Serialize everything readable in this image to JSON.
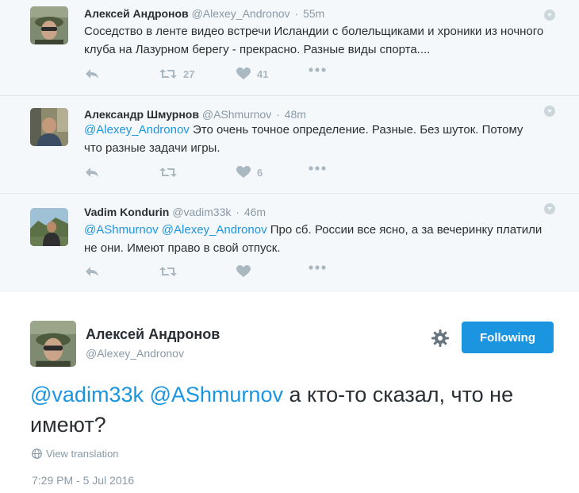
{
  "replies": [
    {
      "name": "Алексей Андронов",
      "handle": "@Alexey_Andronov",
      "time": "55m",
      "segments": [
        {
          "text": "Соседство в ленте видео встречи Исландии с болельщиками и хроники из ночного клуба на Лазурном берегу - прекрасно. Разные виды спорта....",
          "mention": false
        }
      ],
      "retweets": "27",
      "likes": "41"
    },
    {
      "name": "Александр Шмурнов",
      "handle": "@AShmurnov",
      "time": "48m",
      "segments": [
        {
          "text": "@Alexey_Andronov",
          "mention": true
        },
        {
          "text": " Это очень точное определение. Разные. Без шуток. Потому что разные задачи игры.",
          "mention": false
        }
      ],
      "retweets": "",
      "likes": "6"
    },
    {
      "name": "Vadim Kondurin",
      "handle": "@vadim33k",
      "time": "46m",
      "segments": [
        {
          "text": "@AShmurnov",
          "mention": true
        },
        {
          "text": " ",
          "mention": false
        },
        {
          "text": "@Alexey_Andronov",
          "mention": true
        },
        {
          "text": " Про сб. России все ясно, а за вечеринку платили не они. Имеют право в свой отпуск.",
          "mention": false
        }
      ],
      "retweets": "",
      "likes": ""
    }
  ],
  "main_tweet": {
    "name": "Алексей Андронов",
    "handle": "@Alexey_Andronov",
    "follow_label": "Following",
    "segments": [
      {
        "text": "@vadim33k",
        "mention": true
      },
      {
        "text": " ",
        "mention": false
      },
      {
        "text": "@AShmurnov",
        "mention": true
      },
      {
        "text": " а кто-то сказал, что не имеют?",
        "mention": false
      }
    ],
    "translate_label": "View translation",
    "timestamp": "7:29 PM - 5 Jul 2016"
  },
  "icons": {
    "reply": "reply-icon",
    "retweet": "retweet-icon",
    "like": "heart-icon",
    "more": "more-icon",
    "caret": "caret-down-icon",
    "gear": "gear-icon",
    "globe": "globe-icon"
  },
  "colors": {
    "accent": "#1b95e0",
    "muted": "#8899a6",
    "icon": "#aab8c2",
    "reply_bg": "#f5f8fa"
  }
}
